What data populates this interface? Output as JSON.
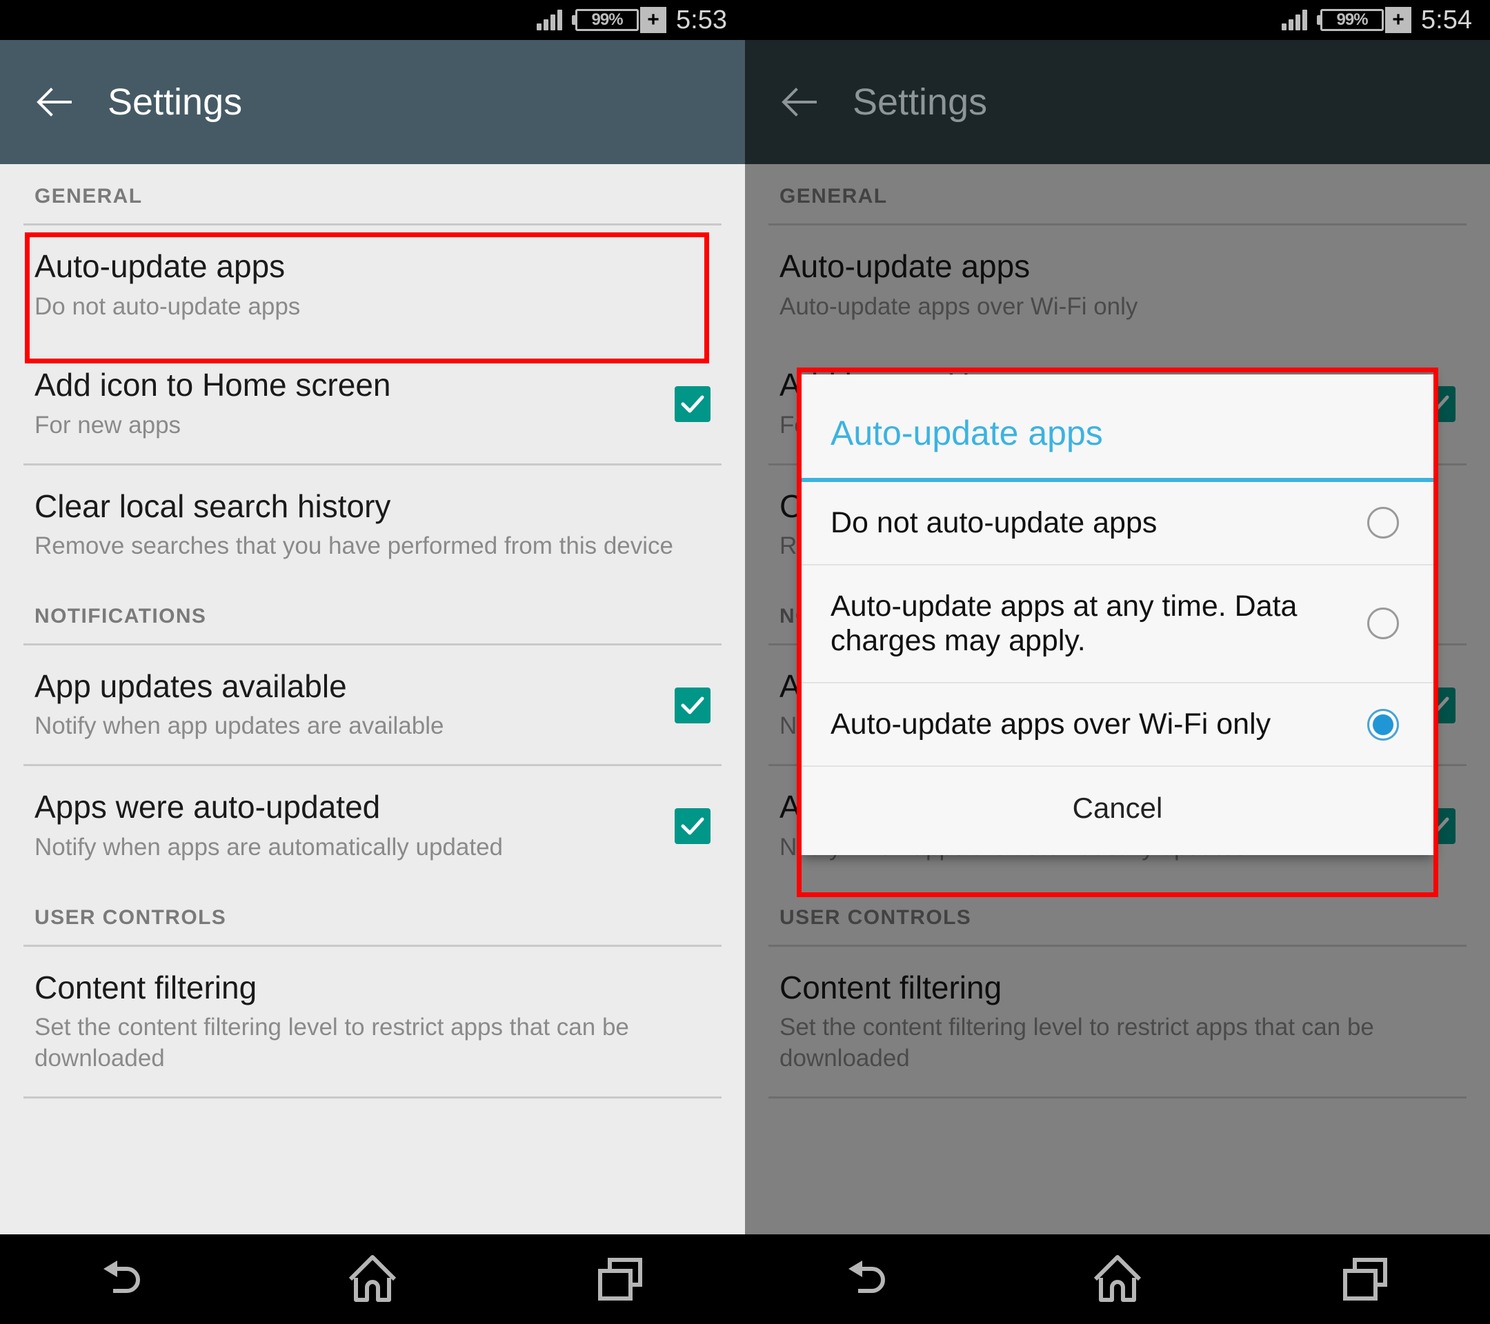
{
  "panels": [
    {
      "id": "left",
      "statusbar": {
        "battery": "99%",
        "charging_glyph": "+",
        "time": "5:53",
        "signal_icon": "signal-bars-icon"
      },
      "actionbar": {
        "title": "Settings",
        "back_icon": "back-arrow-icon"
      },
      "sections": [
        {
          "header": "GENERAL",
          "rows": [
            {
              "title": "Auto-update apps",
              "sub": "Do not auto-update apps",
              "checkbox": false
            },
            {
              "title": "Add icon to Home screen",
              "sub": "For new apps",
              "checkbox": true
            },
            {
              "title": "Clear local search history",
              "sub": "Remove searches that you have performed from this device",
              "checkbox": false
            }
          ]
        },
        {
          "header": "NOTIFICATIONS",
          "rows": [
            {
              "title": "App updates available",
              "sub": "Notify when app updates are available",
              "checkbox": true
            },
            {
              "title": "Apps were auto-updated",
              "sub": "Notify when apps are automatically updated",
              "checkbox": true
            }
          ]
        },
        {
          "header": "USER CONTROLS",
          "rows": [
            {
              "title": "Content filtering",
              "sub": "Set the content filtering level to restrict apps that can be downloaded",
              "checkbox": false
            }
          ]
        }
      ]
    },
    {
      "id": "right",
      "statusbar": {
        "battery": "99%",
        "charging_glyph": "+",
        "time": "5:54",
        "signal_icon": "signal-bars-icon"
      },
      "actionbar": {
        "title": "Settings",
        "back_icon": "back-arrow-icon"
      },
      "sections": [
        {
          "header": "GENERAL",
          "rows": [
            {
              "title": "Auto-update apps",
              "sub": "Auto-update apps over Wi-Fi only",
              "checkbox": false
            },
            {
              "title": "Add icon to Home screen",
              "sub": "For new apps",
              "checkbox": true
            },
            {
              "title": "Clear local search history",
              "sub": "Remove searches that you have performed from this device",
              "checkbox": false
            }
          ]
        },
        {
          "header": "NOTIFICATIONS",
          "rows": [
            {
              "title": "App updates available",
              "sub": "Notify when app updates are available",
              "checkbox": true
            },
            {
              "title": "Apps were auto-updated",
              "sub": "Notify when apps are automatically updated",
              "checkbox": true
            }
          ]
        },
        {
          "header": "USER CONTROLS",
          "rows": [
            {
              "title": "Content filtering",
              "sub": "Set the content filtering level to restrict apps that can be downloaded",
              "checkbox": false
            }
          ]
        }
      ]
    }
  ],
  "dialog": {
    "title": "Auto-update apps",
    "options": [
      {
        "label": "Do not auto-update apps",
        "selected": false
      },
      {
        "label": "Auto-update apps at any time. Data charges may apply.",
        "selected": false
      },
      {
        "label": "Auto-update apps over Wi-Fi only",
        "selected": true
      }
    ],
    "cancel_label": "Cancel"
  },
  "navbar": {
    "buttons": [
      {
        "icon": "back-nav-icon"
      },
      {
        "icon": "home-icon"
      },
      {
        "icon": "recents-icon"
      }
    ]
  },
  "annotations": {
    "accent_red": "#FF0000",
    "header_color": "#455A64",
    "checkbox_color": "#009688",
    "dialog_accent": "#3CB3E0"
  }
}
